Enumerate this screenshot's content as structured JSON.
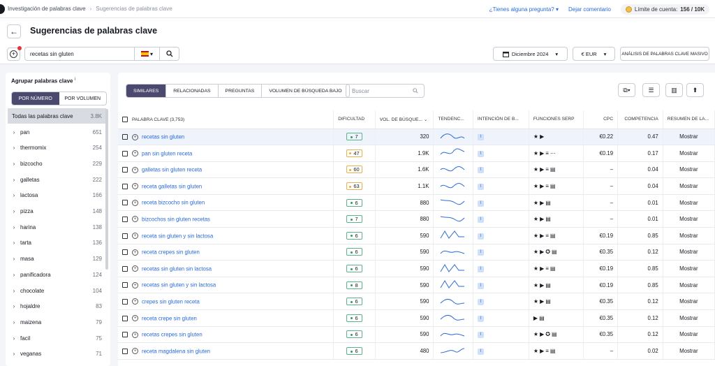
{
  "breadcrumb": [
    "Investigación de palabras clave",
    "Sugerencias de palabras clave"
  ],
  "topbar": {
    "help": "¿Tienes alguna pregunta?",
    "comment": "Dejar comentario",
    "limit_label": "Límite de cuenta:",
    "limit_value": "156 / 10K"
  },
  "page_title": "Sugerencias de palabras clave",
  "search": {
    "value": "recetas sin gluten",
    "flag": "ES"
  },
  "controls": {
    "date": "Diciembre 2024",
    "currency": "€ EUR",
    "bulk": "ANÁLISIS DE PALABRAS CLAVE MASIVO"
  },
  "left": {
    "title": "Agrupar palabras clave",
    "seg_number": "POR NÚMERO",
    "seg_volume": "POR VOLUMEN",
    "all_label": "Todas las palabras clave",
    "all_count": "3.8K",
    "groups": [
      {
        "name": "pan",
        "count": "651"
      },
      {
        "name": "thermomix",
        "count": "254"
      },
      {
        "name": "bizcocho",
        "count": "229"
      },
      {
        "name": "galletas",
        "count": "222"
      },
      {
        "name": "lactosa",
        "count": "166"
      },
      {
        "name": "pizza",
        "count": "148"
      },
      {
        "name": "harina",
        "count": "138"
      },
      {
        "name": "tarta",
        "count": "136"
      },
      {
        "name": "masa",
        "count": "129"
      },
      {
        "name": "panificadora",
        "count": "124"
      },
      {
        "name": "chocolate",
        "count": "104"
      },
      {
        "name": "hojaldre",
        "count": "83"
      },
      {
        "name": "maizena",
        "count": "79"
      },
      {
        "name": "facil",
        "count": "75"
      },
      {
        "name": "veganas",
        "count": "71"
      }
    ]
  },
  "tabs": [
    "SIMILARES",
    "RELACIONADAS",
    "PREGUNTAS",
    "VOLUMEN DE BÚSQUEDA BAJO"
  ],
  "filter_placeholder": "Buscar",
  "columns": [
    "PALABRA CLAVE (3,753)",
    "DIFICULTAD",
    "VOL. DE BÚSQUE...",
    "TENDENC...",
    "INTENCIÓN DE B...",
    "FUNCIONES SERP",
    "CPC",
    "COMPETENCIA",
    "RESUMEN DE LA..."
  ],
  "rows": [
    {
      "kw": "recetas sin gluten",
      "diff": "7",
      "vol": "320",
      "cpc": "€0.22",
      "comp": "0.47",
      "serp": [
        "star",
        "video"
      ],
      "action": "Mostrar"
    },
    {
      "kw": "pan sin gluten receta",
      "diff": "47",
      "vol": "1.9K",
      "cpc": "€0.19",
      "comp": "0.17",
      "serp": [
        "star",
        "video",
        "list",
        "more"
      ],
      "action": "Mostrar"
    },
    {
      "kw": "galletas sin gluten receta",
      "diff": "60",
      "vol": "1.6K",
      "cpc": "–",
      "comp": "0.04",
      "serp": [
        "star",
        "video",
        "list",
        "news"
      ],
      "action": "Mostrar"
    },
    {
      "kw": "receta galletas sin gluten",
      "diff": "63",
      "vol": "1.1K",
      "cpc": "–",
      "comp": "0.04",
      "serp": [
        "star",
        "video",
        "list",
        "news"
      ],
      "action": "Mostrar"
    },
    {
      "kw": "receta bizcocho sin gluten",
      "diff": "6",
      "vol": "880",
      "cpc": "–",
      "comp": "0.01",
      "serp": [
        "star",
        "video",
        "news"
      ],
      "action": "Mostrar"
    },
    {
      "kw": "bizcochos sin gluten recetas",
      "diff": "7",
      "vol": "880",
      "cpc": "–",
      "comp": "0.01",
      "serp": [
        "star",
        "video",
        "news"
      ],
      "action": "Mostrar"
    },
    {
      "kw": "receta sin gluten y sin lactosa",
      "diff": "6",
      "vol": "590",
      "cpc": "€0.19",
      "comp": "0.85",
      "serp": [
        "star",
        "video",
        "list",
        "news"
      ],
      "action": "Mostrar"
    },
    {
      "kw": "receta crepes sin gluten",
      "diff": "6",
      "vol": "590",
      "cpc": "€0.35",
      "comp": "0.12",
      "serp": [
        "star",
        "video",
        "reviews",
        "news"
      ],
      "action": "Mostrar"
    },
    {
      "kw": "recetas sin gluten sin lactosa",
      "diff": "6",
      "vol": "590",
      "cpc": "€0.19",
      "comp": "0.85",
      "serp": [
        "star",
        "video",
        "list",
        "news"
      ],
      "action": "Mostrar"
    },
    {
      "kw": "recetas sin gluten y sin lactosa",
      "diff": "8",
      "vol": "590",
      "cpc": "€0.19",
      "comp": "0.85",
      "serp": [
        "star",
        "video",
        "news"
      ],
      "action": "Mostrar"
    },
    {
      "kw": "crepes sin gluten receta",
      "diff": "6",
      "vol": "590",
      "cpc": "€0.35",
      "comp": "0.12",
      "serp": [
        "star",
        "video",
        "news"
      ],
      "action": "Mostrar"
    },
    {
      "kw": "receta crepe sin gluten",
      "diff": "6",
      "vol": "590",
      "cpc": "€0.35",
      "comp": "0.12",
      "serp": [
        "video",
        "news"
      ],
      "action": "Mostrar"
    },
    {
      "kw": "recetas crepes sin gluten",
      "diff": "6",
      "vol": "590",
      "cpc": "€0.35",
      "comp": "0.12",
      "serp": [
        "star",
        "video",
        "reviews",
        "news"
      ],
      "action": "Mostrar"
    },
    {
      "kw": "receta magdalena sin gluten",
      "diff": "6",
      "vol": "480",
      "cpc": "–",
      "comp": "0.02",
      "serp": [
        "star",
        "video",
        "list",
        "news"
      ],
      "action": "Mostrar"
    }
  ],
  "trend_icons": [
    "trend-sparkline"
  ],
  "intent_label": "I",
  "colors": {
    "accent": "#4b4a6e",
    "link": "#2a6ad8",
    "easy": "#2c9c63",
    "medium": "#f0a52b"
  }
}
